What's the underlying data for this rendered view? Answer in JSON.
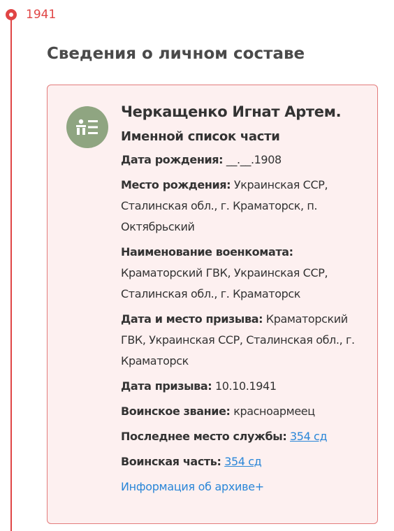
{
  "timeline": {
    "year": "1941"
  },
  "section": {
    "title": "Сведения о личном составе"
  },
  "record": {
    "icon": "person-list-icon",
    "name": "Черкащенко Игнат Артем.",
    "doc_type": "Именной список части",
    "fields": [
      {
        "label": "Дата рождения:",
        "value": " __.__.1908"
      },
      {
        "label": "Место рождения:",
        "value": " Украинская ССР, Сталинская обл., г. Краматорск, п. Октябрьский"
      },
      {
        "label": "Наименование военкомата:",
        "value": " Краматорский ГВК, Украинская ССР, Сталинская обл., г. Краматорск"
      },
      {
        "label": "Дата и место призыва:",
        "value": " Краматорский ГВК, Украинская ССР, Сталинская обл., г. Краматорск"
      },
      {
        "label": "Дата призыва:",
        "value": " 10.10.1941"
      },
      {
        "label": "Воинское звание:",
        "value": " красноармеец"
      },
      {
        "label": "Последнее место службы:",
        "link": "354 сд"
      },
      {
        "label": "Воинская часть:",
        "link": "354 сд"
      }
    ],
    "archive_link": "Информация об архиве+"
  },
  "colors": {
    "accent_red": "#e04545",
    "card_bg": "#fdf0f0",
    "card_border": "#e37b7b",
    "avatar_bg": "#8fa581",
    "link": "#2a86d8"
  }
}
